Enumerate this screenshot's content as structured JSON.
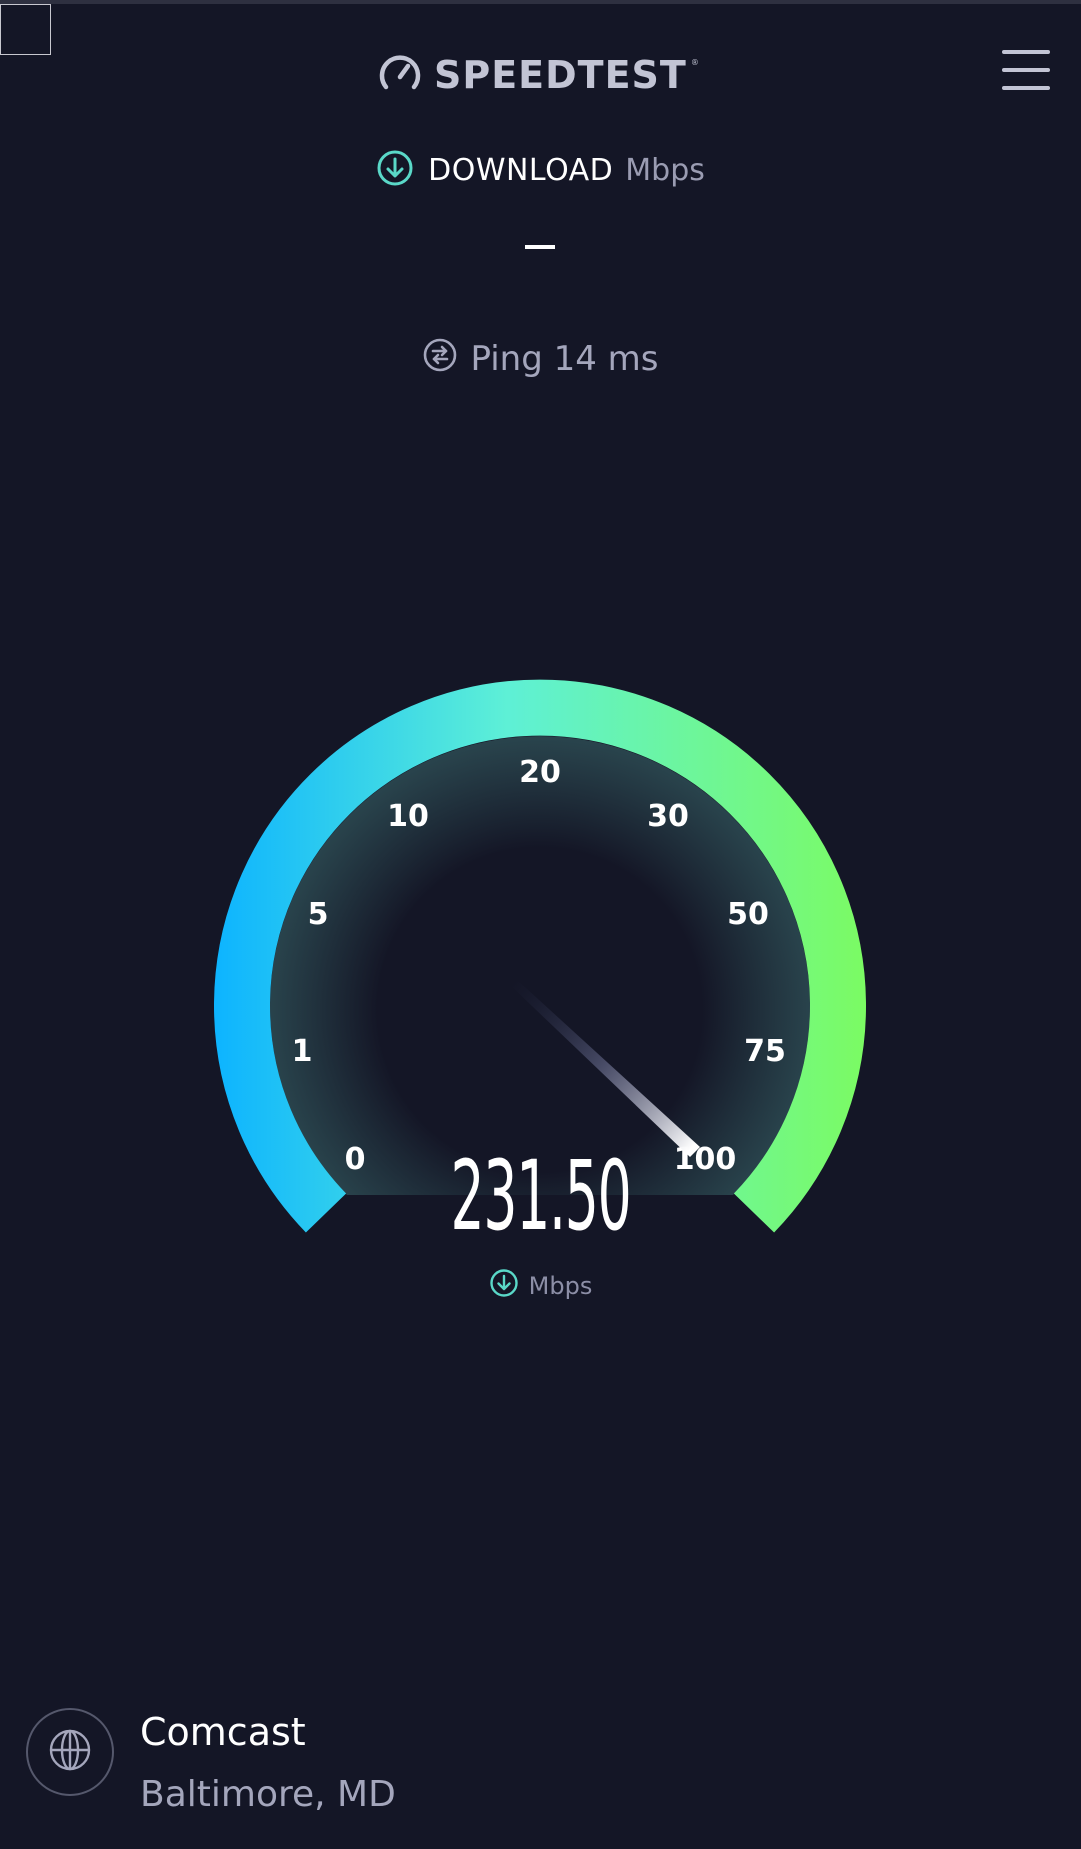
{
  "app": {
    "logo_text": "SPEEDTEST",
    "trademark": "®"
  },
  "icons": {
    "logo": "gauge-logo-icon",
    "menu": "hamburger-menu-icon",
    "download": "download-arrow-icon",
    "ping": "ping-icon",
    "globe": "globe-icon"
  },
  "test": {
    "download_label": "DOWNLOAD",
    "download_unit": "Mbps",
    "download_placeholder": "–",
    "ping_text": "Ping 14 ms"
  },
  "gauge": {
    "ticks": [
      "0",
      "1",
      "5",
      "10",
      "20",
      "30",
      "50",
      "75",
      "100"
    ],
    "current_value": "231.50",
    "unit": "Mbps",
    "needle_level": 1.0,
    "colors": {
      "start": "#0db4ff",
      "mid": "#5ef0d6",
      "end": "#7bfb63"
    }
  },
  "server": {
    "isp": "Comcast",
    "location": "Baltimore, MD"
  },
  "colors": {
    "background": "#141626",
    "accent": "#5ad8c8",
    "muted_text": "#a4a6bc"
  }
}
